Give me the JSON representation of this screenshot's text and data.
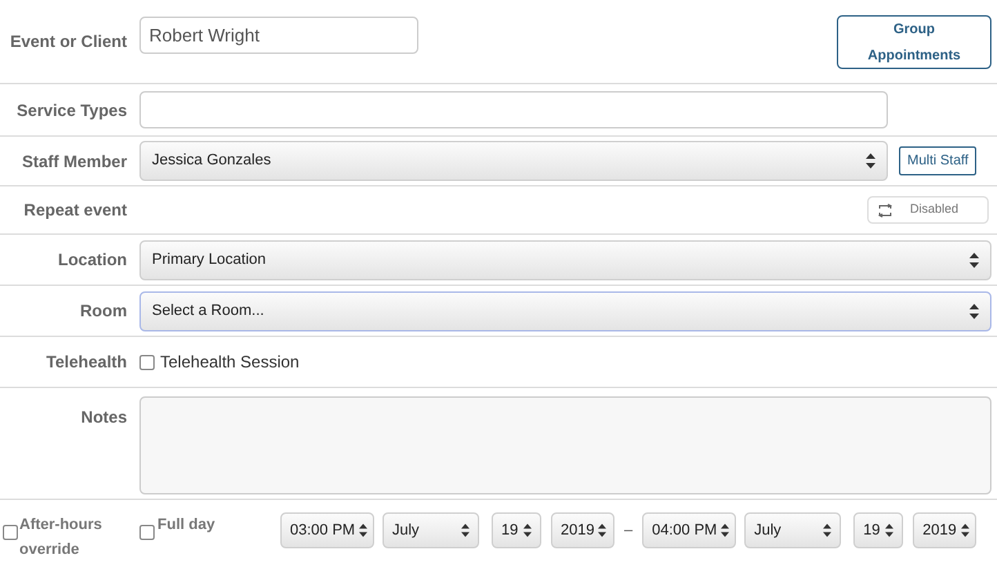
{
  "event_or_client": {
    "label": "Event or Client",
    "value": "Robert Wright"
  },
  "group_button": "Group Appointments",
  "service_types": {
    "label": "Service Types"
  },
  "staff_member": {
    "label": "Staff Member",
    "value": "Jessica Gonzales"
  },
  "multi_staff_button": "Multi Staff",
  "repeat_event": {
    "label": "Repeat event",
    "toggle": "Disabled"
  },
  "location": {
    "label": "Location",
    "value": "Primary Location"
  },
  "room": {
    "label": "Room",
    "value": "Select a Room...",
    "focused": true
  },
  "telehealth": {
    "label": "Telehealth",
    "option": "Telehealth Session",
    "checked": false
  },
  "notes": {
    "label": "Notes"
  },
  "after_hours": {
    "label": "After-hours override",
    "checked": false
  },
  "full_day": {
    "label": "Full day",
    "checked": false
  },
  "start": {
    "time": "03:00 PM",
    "month": "July",
    "day": "19",
    "year": "2019"
  },
  "separator": "–",
  "end": {
    "time": "04:00 PM",
    "month": "July",
    "day": "19",
    "year": "2019"
  }
}
